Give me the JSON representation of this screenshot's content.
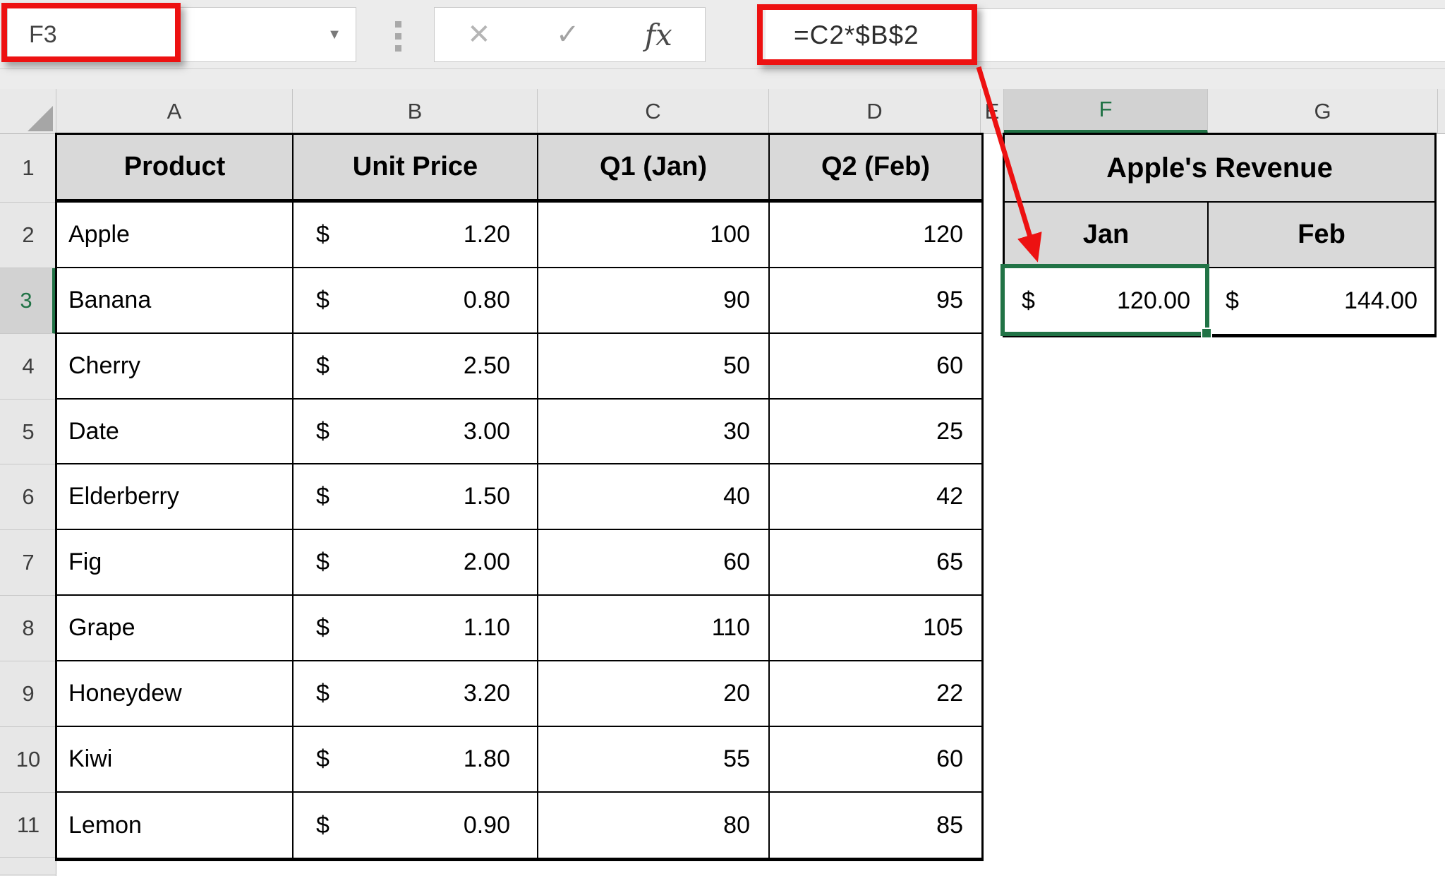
{
  "toolbar": {
    "name_box": {
      "value": "F3",
      "dropdown_glyph": "▼"
    },
    "formula_bar": {
      "value": "=C2*$B$2",
      "cancel_glyph": "✕",
      "enter_glyph": "✓",
      "fx_label": "fx"
    }
  },
  "sheet": {
    "column_letters": [
      "A",
      "B",
      "C",
      "D",
      "E",
      "F",
      "G"
    ],
    "row_numbers": [
      "1",
      "2",
      "3",
      "4",
      "5",
      "6",
      "7",
      "8",
      "9",
      "10",
      "11"
    ],
    "selected_cell_ref": "F3",
    "selected_column": "F",
    "selected_row": "3"
  },
  "currency_symbol": "$",
  "products_table": {
    "headers": {
      "product": "Product",
      "unit_price": "Unit Price",
      "q1": "Q1 (Jan)",
      "q2": "Q2 (Feb)"
    },
    "rows": [
      {
        "product": "Apple",
        "unit_price": "1.20",
        "q1": "100",
        "q2": "120"
      },
      {
        "product": "Banana",
        "unit_price": "0.80",
        "q1": "90",
        "q2": "95"
      },
      {
        "product": "Cherry",
        "unit_price": "2.50",
        "q1": "50",
        "q2": "60"
      },
      {
        "product": "Date",
        "unit_price": "3.00",
        "q1": "30",
        "q2": "25"
      },
      {
        "product": "Elderberry",
        "unit_price": "1.50",
        "q1": "40",
        "q2": "42"
      },
      {
        "product": "Fig",
        "unit_price": "2.00",
        "q1": "60",
        "q2": "65"
      },
      {
        "product": "Grape",
        "unit_price": "1.10",
        "q1": "110",
        "q2": "105"
      },
      {
        "product": "Honeydew",
        "unit_price": "3.20",
        "q1": "20",
        "q2": "22"
      },
      {
        "product": "Kiwi",
        "unit_price": "1.80",
        "q1": "55",
        "q2": "60"
      },
      {
        "product": "Lemon",
        "unit_price": "0.90",
        "q1": "80",
        "q2": "85"
      }
    ]
  },
  "revenue_table": {
    "title": "Apple's Revenue",
    "jan_header": "Jan",
    "feb_header": "Feb",
    "jan_value": "120.00",
    "feb_value": "144.00"
  },
  "colors": {
    "selection_green": "#217346",
    "annotation_red": "#ed1111",
    "table_header_fill": "#d9d9d9",
    "band_fill": "#e9e9e9"
  }
}
